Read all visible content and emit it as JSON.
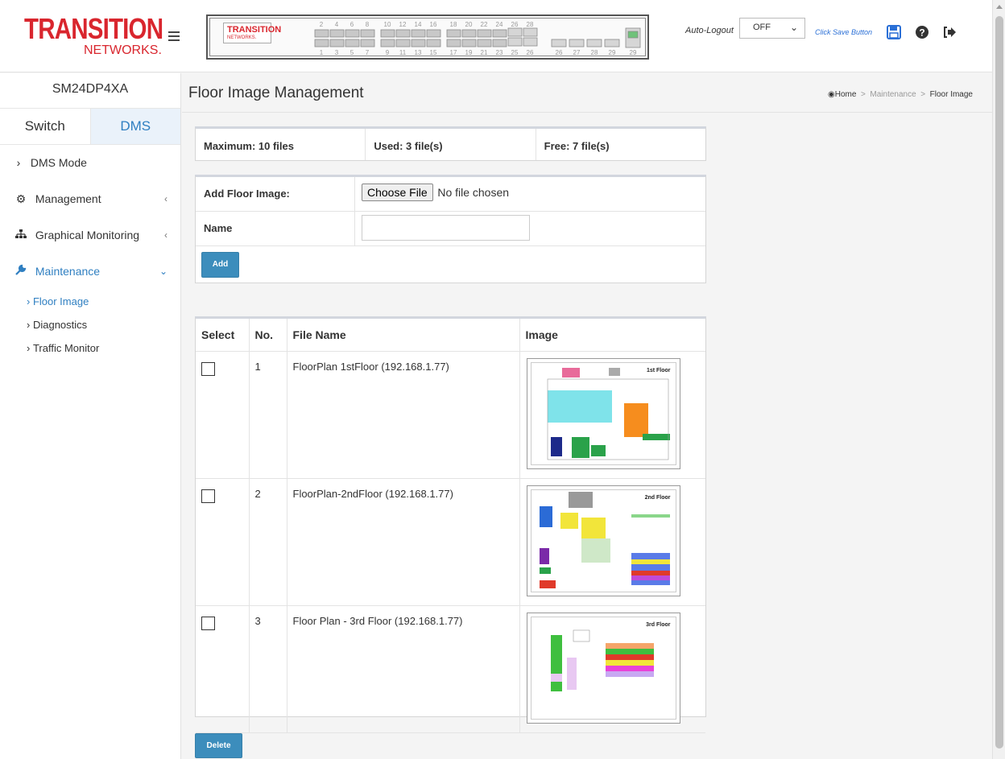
{
  "brand": {
    "logo_main": "TRANSITION",
    "logo_sub": "NETWORKS.",
    "panel_logo_main": "TRANSITION",
    "panel_logo_sub": "NETWORKS."
  },
  "switch_panel": {
    "top_numbers": [
      "2",
      "4",
      "6",
      "8",
      "10",
      "12",
      "14",
      "16",
      "18",
      "20",
      "22",
      "24",
      "26",
      "28"
    ],
    "bottom_numbers": [
      "1",
      "3",
      "5",
      "7",
      "9",
      "11",
      "13",
      "15",
      "17",
      "19",
      "21",
      "23",
      "21",
      "23",
      "25",
      "26",
      "27",
      "28",
      "29"
    ]
  },
  "header": {
    "auto_logout_label": "Auto-Logout",
    "auto_logout_value": "OFF",
    "save_text": "Click Save Button"
  },
  "sidebar": {
    "device_name": "SM24DP4XA",
    "tabs": [
      {
        "label": "Switch",
        "active": false
      },
      {
        "label": "DMS",
        "active": true
      }
    ],
    "items": [
      {
        "label": "DMS Mode"
      },
      {
        "label": "Management"
      },
      {
        "label": "Graphical Monitoring"
      },
      {
        "label": "Maintenance"
      }
    ],
    "subitems": [
      {
        "label": "Floor Image",
        "active": true
      },
      {
        "label": "Diagnostics",
        "active": false
      },
      {
        "label": "Traffic Monitor",
        "active": false
      }
    ]
  },
  "page": {
    "title": "Floor Image Management",
    "breadcrumb": [
      "Home",
      "Maintenance",
      "Floor Image"
    ]
  },
  "stats": {
    "maximum": "Maximum: 10 files",
    "used": "Used: 3 file(s)",
    "free": "Free: 7 file(s)"
  },
  "add_form": {
    "add_label": "Add Floor Image:",
    "choose_file": "Choose File",
    "no_file": "No file chosen",
    "name_label": "Name",
    "name_value": "",
    "add_button": "Add"
  },
  "file_table": {
    "headers": [
      "Select",
      "No.",
      "File Name",
      "Image"
    ],
    "rows": [
      {
        "no": "1",
        "name": "FloorPlan 1stFloor (192.168.1.77)",
        "thumb_title": "1st Floor"
      },
      {
        "no": "2",
        "name": "FloorPlan-2ndFloor (192.168.1.77)",
        "thumb_title": "2nd Floor"
      },
      {
        "no": "3",
        "name": "Floor Plan - 3rd Floor (192.168.1.77)",
        "thumb_title": "3rd Floor"
      }
    ],
    "delete_button": "Delete"
  }
}
